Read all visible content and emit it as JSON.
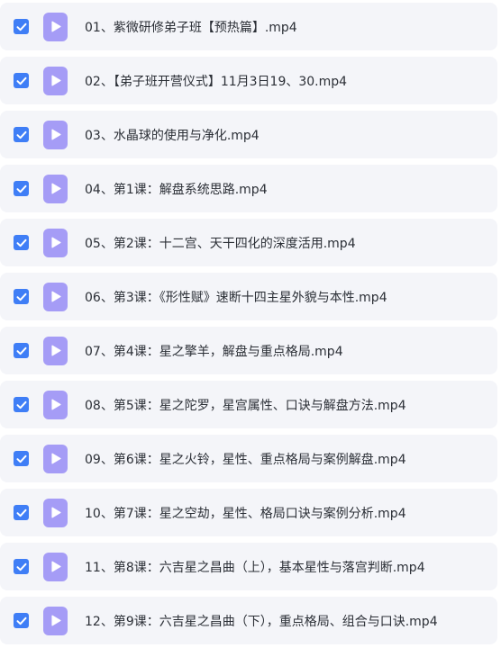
{
  "colors": {
    "row_background": "#f4f5f9",
    "checkbox": "#3f7ef6",
    "video_icon": "#a59cf6",
    "text": "#2b2f36"
  },
  "files": [
    {
      "name": "01、紫微研修弟子班【预热篇】.mp4",
      "checked": true,
      "icon": "video-file-icon"
    },
    {
      "name": "02、【弟子班开营仪式】11月3日19、30.mp4",
      "checked": true,
      "icon": "video-file-icon"
    },
    {
      "name": "03、水晶球的使用与净化.mp4",
      "checked": true,
      "icon": "video-file-icon"
    },
    {
      "name": "04、第1课：解盘系统思路.mp4",
      "checked": true,
      "icon": "video-file-icon"
    },
    {
      "name": "05、第2课：十二宫、天干四化的深度活用.mp4",
      "checked": true,
      "icon": "video-file-icon"
    },
    {
      "name": "06、第3课：《形性赋》速断十四主星外貌与本性.mp4",
      "checked": true,
      "icon": "video-file-icon"
    },
    {
      "name": "07、第4课：星之擎羊，解盘与重点格局.mp4",
      "checked": true,
      "icon": "video-file-icon"
    },
    {
      "name": "08、第5课：星之陀罗，星宫属性、口诀与解盘方法.mp4",
      "checked": true,
      "icon": "video-file-icon"
    },
    {
      "name": "09、第6课：星之火铃，星性、重点格局与案例解盘.mp4",
      "checked": true,
      "icon": "video-file-icon"
    },
    {
      "name": "10、第7课：星之空劫，星性、格局口诀与案例分析.mp4",
      "checked": true,
      "icon": "video-file-icon"
    },
    {
      "name": "11、第8课：六吉星之昌曲（上），基本星性与落宫判断.mp4",
      "checked": true,
      "icon": "video-file-icon"
    },
    {
      "name": "12、第9课：六吉星之昌曲（下），重点格局、组合与口诀.mp4",
      "checked": true,
      "icon": "video-file-icon"
    }
  ]
}
